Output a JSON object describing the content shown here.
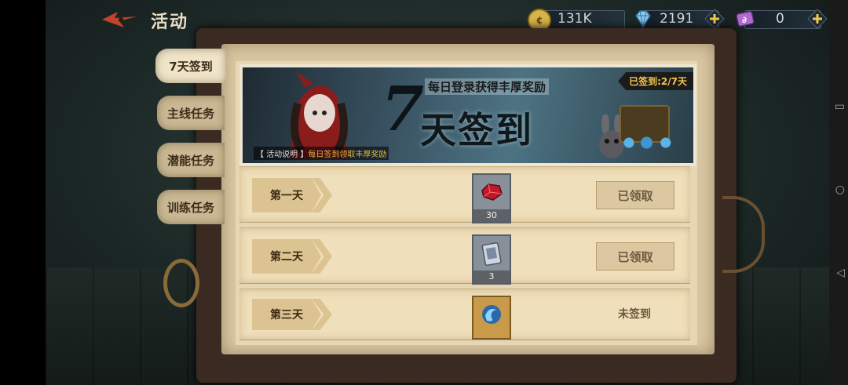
{
  "header": {
    "title": "活动"
  },
  "resources": [
    {
      "name": "coin",
      "value": "131K",
      "color": "#d9b44a",
      "icon": "coin-icon"
    },
    {
      "name": "diamond",
      "value": "2191",
      "color": "#6ab0e0",
      "icon": "diamond-icon"
    },
    {
      "name": "ticket",
      "value": "0",
      "color": "#b06ad0",
      "icon": "ticket-icon"
    }
  ],
  "tabs": [
    {
      "label": "7天签到",
      "active": true
    },
    {
      "label": "主线任务",
      "active": false
    },
    {
      "label": "潜能任务",
      "active": false
    },
    {
      "label": "训练任务",
      "active": false
    }
  ],
  "banner": {
    "title_seven": "7",
    "title": "天签到",
    "subtitle": "每日登录获得丰厚奖励",
    "progress": "已签到:2/7天",
    "desc_key": "【 活动说明 】",
    "desc_value": "每日签到领取丰厚奖励"
  },
  "days": [
    {
      "label": "第一天",
      "reward_count": "30",
      "reward_icon": "red-gem-icon",
      "status": "已领取",
      "claimed": true
    },
    {
      "label": "第二天",
      "reward_count": "3",
      "reward_icon": "card-icon",
      "status": "已领取",
      "claimed": true
    },
    {
      "label": "第三天",
      "reward_count": "",
      "reward_icon": "blue-swirl-icon",
      "status": "未签到",
      "claimed": false
    }
  ]
}
